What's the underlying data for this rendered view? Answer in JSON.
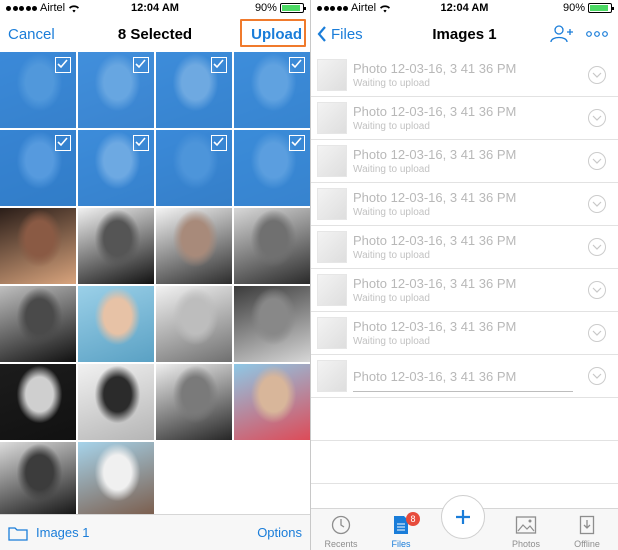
{
  "left": {
    "status": {
      "carrier": "Airtel",
      "time": "12:04 AM",
      "battery": "90%",
      "battery_level": 0.9
    },
    "nav": {
      "cancel": "Cancel",
      "title": "8 Selected",
      "upload": "Upload"
    },
    "photos": [
      {
        "selected": true,
        "colors": [
          "#3a7fcf",
          "#79a9d6",
          "#2c66aa"
        ]
      },
      {
        "selected": true,
        "colors": [
          "#4c8fd8",
          "#b8cfe5",
          "#396fb2"
        ]
      },
      {
        "selected": true,
        "colors": [
          "#3f86d2",
          "#cdd9e6",
          "#2f6cb0"
        ]
      },
      {
        "selected": true,
        "colors": [
          "#4189d4",
          "#a5c5e4",
          "#3070b4"
        ]
      },
      {
        "selected": true,
        "colors": [
          "#2e6fbd",
          "#86aede",
          "#1f5a9e"
        ]
      },
      {
        "selected": true,
        "colors": [
          "#3f86d2",
          "#c9d8ea",
          "#2c66aa"
        ]
      },
      {
        "selected": true,
        "colors": [
          "#3a80cf",
          "#6f9fd2",
          "#29609f"
        ]
      },
      {
        "selected": true,
        "colors": [
          "#3985d0",
          "#95badf",
          "#2f6cb0"
        ]
      },
      {
        "selected": false,
        "colors": [
          "#2a1d18",
          "#8a5a44",
          "#d9a47d"
        ]
      },
      {
        "selected": false,
        "colors": [
          "#f1f1f1",
          "#555555",
          "#111111"
        ]
      },
      {
        "selected": false,
        "colors": [
          "#f4f4f4",
          "#a88a7a",
          "#2c2c2c"
        ]
      },
      {
        "selected": false,
        "colors": [
          "#d8d8d8",
          "#707070",
          "#2a2a2a"
        ]
      },
      {
        "selected": false,
        "colors": [
          "#bfbfbf",
          "#4a4a4a",
          "#101010"
        ]
      },
      {
        "selected": false,
        "colors": [
          "#9bd0e8",
          "#e7c2a6",
          "#5aa1c4"
        ]
      },
      {
        "selected": false,
        "colors": [
          "#f2f2f2",
          "#bdbdbd",
          "#6f6f6f"
        ]
      },
      {
        "selected": false,
        "colors": [
          "#3a3a3a",
          "#888888",
          "#d7d7d7"
        ]
      },
      {
        "selected": false,
        "colors": [
          "#1c1c1c",
          "#cfcfcf",
          "#111111"
        ]
      },
      {
        "selected": false,
        "colors": [
          "#f1f1f1",
          "#2b2b2b",
          "#b5b5b5"
        ]
      },
      {
        "selected": false,
        "colors": [
          "#efefef",
          "#7a7a7a",
          "#262626"
        ]
      },
      {
        "selected": false,
        "colors": [
          "#8ec8e6",
          "#d8b69a",
          "#dd4b58"
        ]
      },
      {
        "selected": false,
        "colors": [
          "#dcdcdc",
          "#3c3c3c",
          "#0f0f0f"
        ]
      },
      {
        "selected": false,
        "colors": [
          "#a6d3ea",
          "#f0f0f0",
          "#7a5a48"
        ]
      }
    ],
    "bottom": {
      "folder": "Images 1",
      "options": "Options"
    }
  },
  "right": {
    "status": {
      "carrier": "Airtel",
      "time": "12:04 AM",
      "battery": "90%",
      "battery_level": 0.9
    },
    "nav": {
      "back": "Files",
      "title": "Images 1"
    },
    "items": [
      {
        "title": "Photo 12-03-16, 3 41 36 PM",
        "status": "Waiting to upload"
      },
      {
        "title": "Photo 12-03-16, 3 41 36 PM",
        "status": "Waiting to upload"
      },
      {
        "title": "Photo 12-03-16, 3 41 36 PM",
        "status": "Waiting to upload"
      },
      {
        "title": "Photo 12-03-16, 3 41 36 PM",
        "status": "Waiting to upload"
      },
      {
        "title": "Photo 12-03-16, 3 41 36 PM",
        "status": "Waiting to upload"
      },
      {
        "title": "Photo 12-03-16, 3 41 36 PM",
        "status": "Waiting to upload"
      },
      {
        "title": "Photo 12-03-16, 3 41 36 PM",
        "status": "Waiting to upload"
      },
      {
        "title": "Photo 12-03-16, 3 41 36 PM",
        "status": ""
      }
    ],
    "tabs": [
      {
        "label": "Recents",
        "icon": "clock-icon"
      },
      {
        "label": "Files",
        "icon": "file-icon",
        "badge": "8"
      },
      {
        "label": "",
        "icon": "plus-icon"
      },
      {
        "label": "Photos",
        "icon": "photos-icon"
      },
      {
        "label": "Offline",
        "icon": "offline-icon"
      }
    ]
  },
  "colors": {
    "accent": "#1a7dd9",
    "highlight": "#f07a2c",
    "badge": "#e74c3c"
  }
}
